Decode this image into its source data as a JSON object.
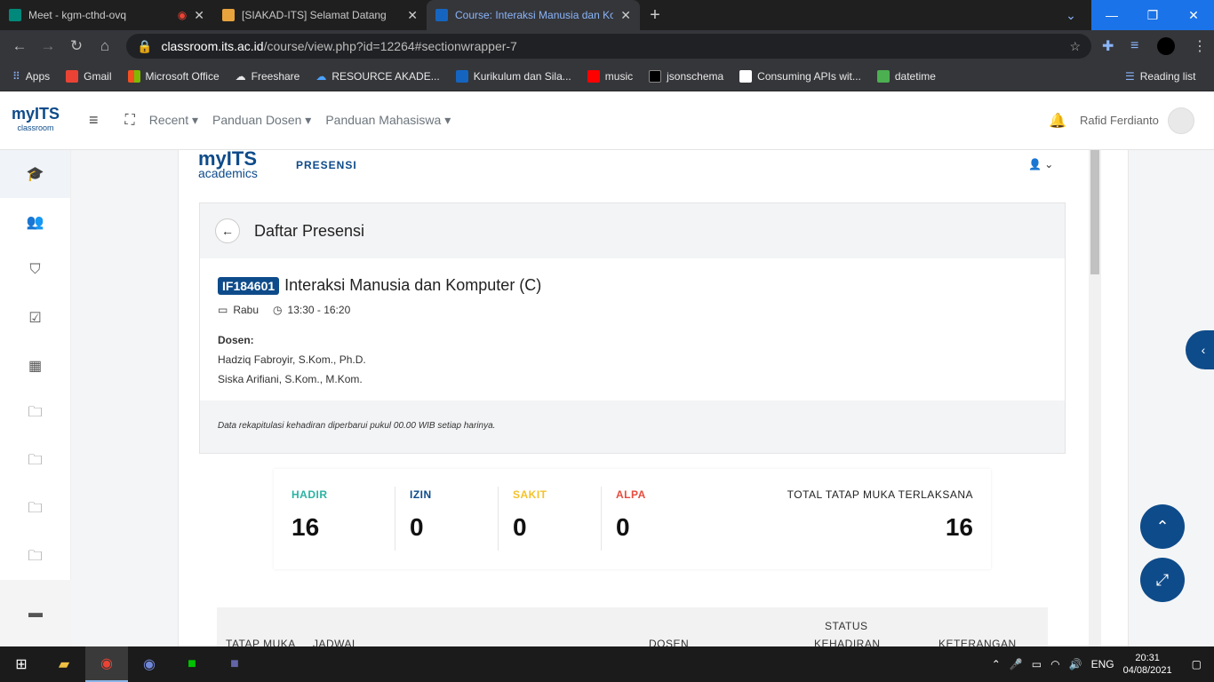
{
  "browser": {
    "tabs": [
      {
        "title": "Meet - kgm-cthd-ovq",
        "color": "#00897b"
      },
      {
        "title": "[SIAKAD-ITS] Selamat Datang",
        "color": "#e8a33d"
      },
      {
        "title": "Course: Interaksi Manusia dan Ko",
        "color": "#1565c0"
      }
    ],
    "url_host": "classroom.its.ac.id",
    "url_path": "/course/view.php?id=12264#sectionwrapper-7",
    "bookmarks": [
      "Apps",
      "Gmail",
      "Microsoft Office",
      "Freeshare",
      "RESOURCE AKADE...",
      "Kurikulum dan Sila...",
      "music",
      "jsonschema",
      "Consuming APIs wit...",
      "datetime"
    ],
    "reading_list": "Reading list"
  },
  "topnav": {
    "logo": "myITS",
    "logo_sub": "classroom",
    "menu": [
      "Recent",
      "Panduan Dosen",
      "Panduan Mahasiswa"
    ],
    "user": "Rafid Ferdianto"
  },
  "header": {
    "brand": "myITS",
    "brand_sub": "academics",
    "section": "PRESENSI"
  },
  "card": {
    "title": "Daftar Presensi",
    "code": "IF184601",
    "course": "Interaksi Manusia dan Komputer (C)",
    "day": "Rabu",
    "time": "13:30 - 16:20",
    "dosen_label": "Dosen:",
    "dosen": [
      "Hadziq Fabroyir, S.Kom., Ph.D.",
      "Siska Arifiani, S.Kom., M.Kom."
    ],
    "note": "Data rekapitulasi kehadiran diperbarui pukul 00.00 WIB setiap harinya."
  },
  "stats": [
    {
      "label": "HADIR",
      "value": "16",
      "color": "#2bb3a3"
    },
    {
      "label": "IZIN",
      "value": "0",
      "color": "#0e4b8a"
    },
    {
      "label": "SAKIT",
      "value": "0",
      "color": "#f4c22b"
    },
    {
      "label": "ALPA",
      "value": "0",
      "color": "#e74c3c"
    }
  ],
  "total": {
    "label": "TOTAL TATAP MUKA TERLAKSANA",
    "value": "16"
  },
  "table": {
    "headers": [
      "TATAP MUKA",
      "JADWAL",
      "DOSEN",
      "STATUS",
      "KEHADIRAN",
      "KETERANGAN"
    ]
  },
  "taskbar": {
    "lang": "ENG",
    "time": "20:31",
    "date": "04/08/2021"
  }
}
